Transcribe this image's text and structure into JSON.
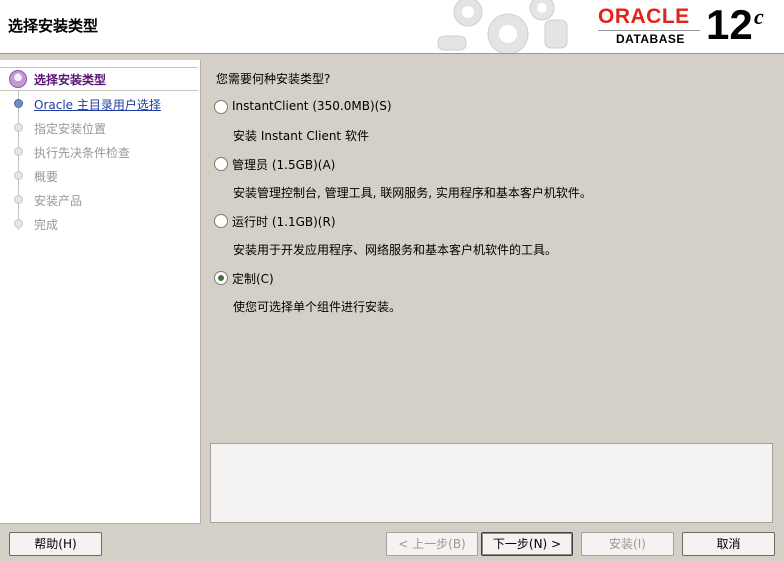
{
  "header": {
    "title": "选择安装类型",
    "brand_word": "ORACLE",
    "brand_sub": "DATABASE",
    "version": "12",
    "version_suffix": "c",
    "brand_color": "#e2231a"
  },
  "steps": [
    {
      "label": "选择安装类型",
      "state": "current"
    },
    {
      "label": "Oracle 主目录用户选择",
      "state": "link"
    },
    {
      "label": "指定安装位置",
      "state": "disabled"
    },
    {
      "label": "执行先决条件检查",
      "state": "disabled"
    },
    {
      "label": "概要",
      "state": "disabled"
    },
    {
      "label": "安装产品",
      "state": "disabled"
    },
    {
      "label": "完成",
      "state": "disabled"
    }
  ],
  "main": {
    "question": "您需要何种安装类型?",
    "options": [
      {
        "label": "InstantClient (350.0MB)(S)",
        "desc": "安装 Instant Client 软件",
        "checked": false
      },
      {
        "label": "管理员 (1.5GB)(A)",
        "desc": "安装管理控制台, 管理工具, 联网服务, 实用程序和基本客户机软件。",
        "checked": false
      },
      {
        "label": "运行时 (1.1GB)(R)",
        "desc": "安装用于开发应用程序、网络服务和基本客户机软件的工具。",
        "checked": false
      },
      {
        "label": "定制(C)",
        "desc": "使您可选择单个组件进行安装。",
        "checked": true
      }
    ],
    "message": ""
  },
  "buttons": {
    "help": "帮助(H)",
    "back": "< 上一步(B)",
    "next": "下一步(N) >",
    "install": "安装(I)",
    "cancel": "取消"
  }
}
